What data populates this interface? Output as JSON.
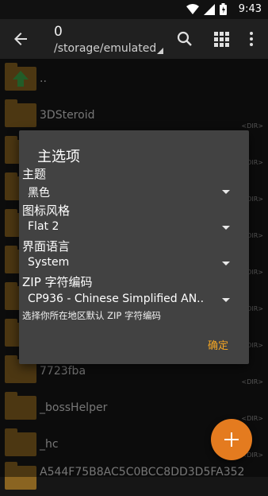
{
  "status_bar": {
    "time": "9:43",
    "icons": [
      "wifi-icon",
      "cellular-icon",
      "battery-icon"
    ]
  },
  "app_bar": {
    "title": "0",
    "path": "/storage/emulated",
    "actions": [
      "search-icon",
      "grid-view-icon",
      "more-vert-icon"
    ]
  },
  "file_list": {
    "parent": "..",
    "items": [
      {
        "name": "3DSteroid",
        "tag": "<DIR>"
      },
      {
        "name": "",
        "tag": "<DIR>"
      },
      {
        "name": "",
        "tag": "<DIR>"
      },
      {
        "name": "",
        "tag": "<DIR>"
      },
      {
        "name": "",
        "tag": "<DIR>"
      },
      {
        "name": "",
        "tag": "<DIR>"
      },
      {
        "name": "",
        "tag": "<DIR>"
      },
      {
        "name": "7723fba",
        "tag": "<DIR>"
      },
      {
        "name": "_bossHelper",
        "tag": "<DIR>"
      },
      {
        "name": "_hc",
        "tag": "<DIR>"
      },
      {
        "name": "A544F75B8AC5C0BCC8DD3D5FA352",
        "tag": ""
      }
    ]
  },
  "dialog": {
    "title": "主选项",
    "theme_label": "主题",
    "theme_value": "黑色",
    "icon_style_label": "图标风格",
    "icon_style_value": "Flat 2",
    "ui_language_label": "界面语言",
    "ui_language_value": "System",
    "zip_encoding_label": "ZIP 字符编码",
    "zip_encoding_value": "CP936 - Chinese Simplified AN..",
    "zip_hint": "选择你所在地区默认 ZIP 字符编码",
    "ok_label": "确定"
  },
  "colors": {
    "accent": "#f5a623",
    "fab": "#e47b1f",
    "folder": "#8a6421",
    "dialog_bg": "#424242"
  }
}
